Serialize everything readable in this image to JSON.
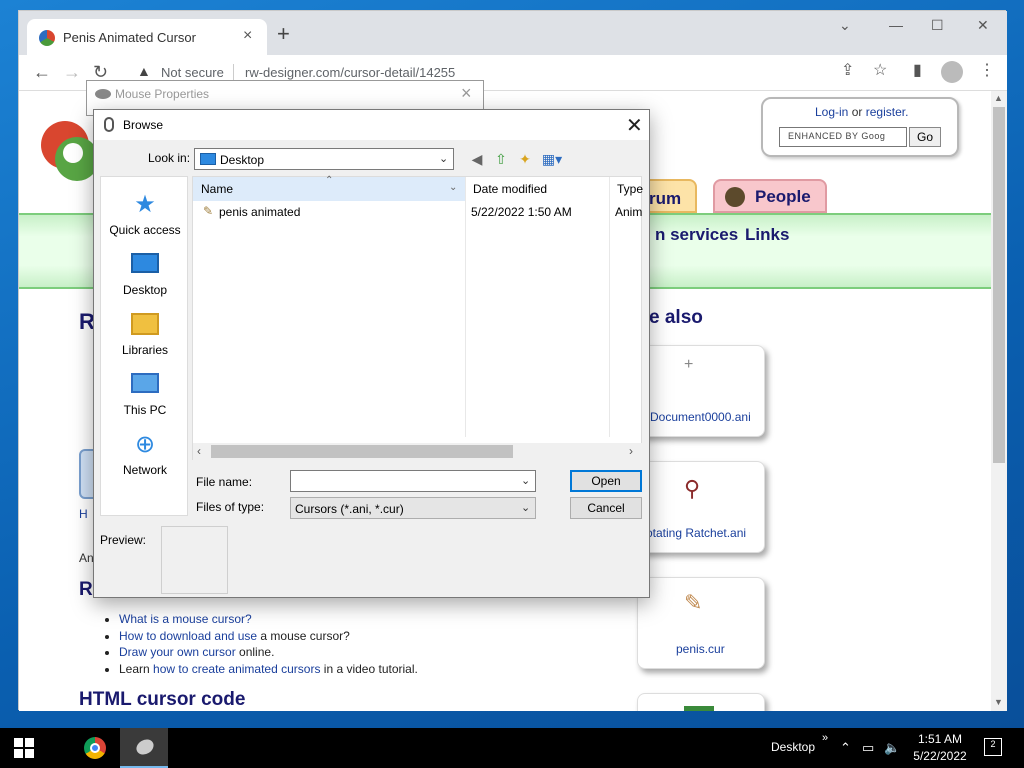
{
  "browser": {
    "tab_title": "Penis Animated Cursor",
    "new_tab": "+",
    "omnibox_security": "Not secure",
    "omnibox_url": "rw-designer.com/cursor-detail/14255"
  },
  "page": {
    "login": {
      "login_link": "Log-in",
      "or": "or",
      "register_link": "register."
    },
    "google_search_placeholder": "ENHANCED BY Goog",
    "go_label": "Go",
    "tabs": {
      "forum": "rum",
      "people": "People"
    },
    "nav": {
      "services": "n services",
      "links": "Links"
    },
    "see_also_heading": "e also",
    "see_also_cards": [
      {
        "label": "Document0000.ani",
        "icon": "crosshair-icon"
      },
      {
        "label": "rotating Ratchet.ani",
        "icon": "ratchet-icon"
      },
      {
        "label": "penis.cur",
        "icon": "cursor-icon"
      },
      {
        "label": "",
        "icon": "green-image-icon"
      }
    ],
    "left_fragments": {
      "r1": "R",
      "h": "H",
      "an": "An",
      "r2": "R"
    },
    "bullets": [
      {
        "link": "What is a mouse cursor?",
        "suffix": ""
      },
      {
        "link": "How to download and use",
        "suffix": " a mouse cursor?"
      },
      {
        "link": "Draw your own cursor",
        "suffix": " online."
      },
      {
        "prefix": "Learn ",
        "link": "how to create animated cursors",
        "suffix": " in a video tutorial."
      }
    ],
    "html_code_heading": "HTML cursor code"
  },
  "mouse_properties": {
    "title": "Mouse Properties"
  },
  "browse_dialog": {
    "title": "Browse",
    "look_in_label": "Look in:",
    "look_in_value": "Desktop",
    "places": [
      {
        "label": "Quick access",
        "icon": "star-icon"
      },
      {
        "label": "Desktop",
        "icon": "desktop-icon"
      },
      {
        "label": "Libraries",
        "icon": "folder-icon"
      },
      {
        "label": "This PC",
        "icon": "computer-icon"
      },
      {
        "label": "Network",
        "icon": "network-icon"
      }
    ],
    "columns": {
      "name": "Name",
      "date_modified": "Date modified",
      "type": "Type"
    },
    "files": [
      {
        "name": "penis animated",
        "date_modified": "5/22/2022 1:50 AM",
        "type": "Anim"
      }
    ],
    "file_name_label": "File name:",
    "file_name_value": "",
    "files_of_type_label": "Files of type:",
    "files_of_type_value": "Cursors (*.ani, *.cur)",
    "open_label": "Open",
    "cancel_label": "Cancel",
    "preview_label": "Preview:"
  },
  "taskbar": {
    "desktop_label": "Desktop",
    "time": "1:51 AM",
    "date": "5/22/2022",
    "notifications": "2"
  }
}
